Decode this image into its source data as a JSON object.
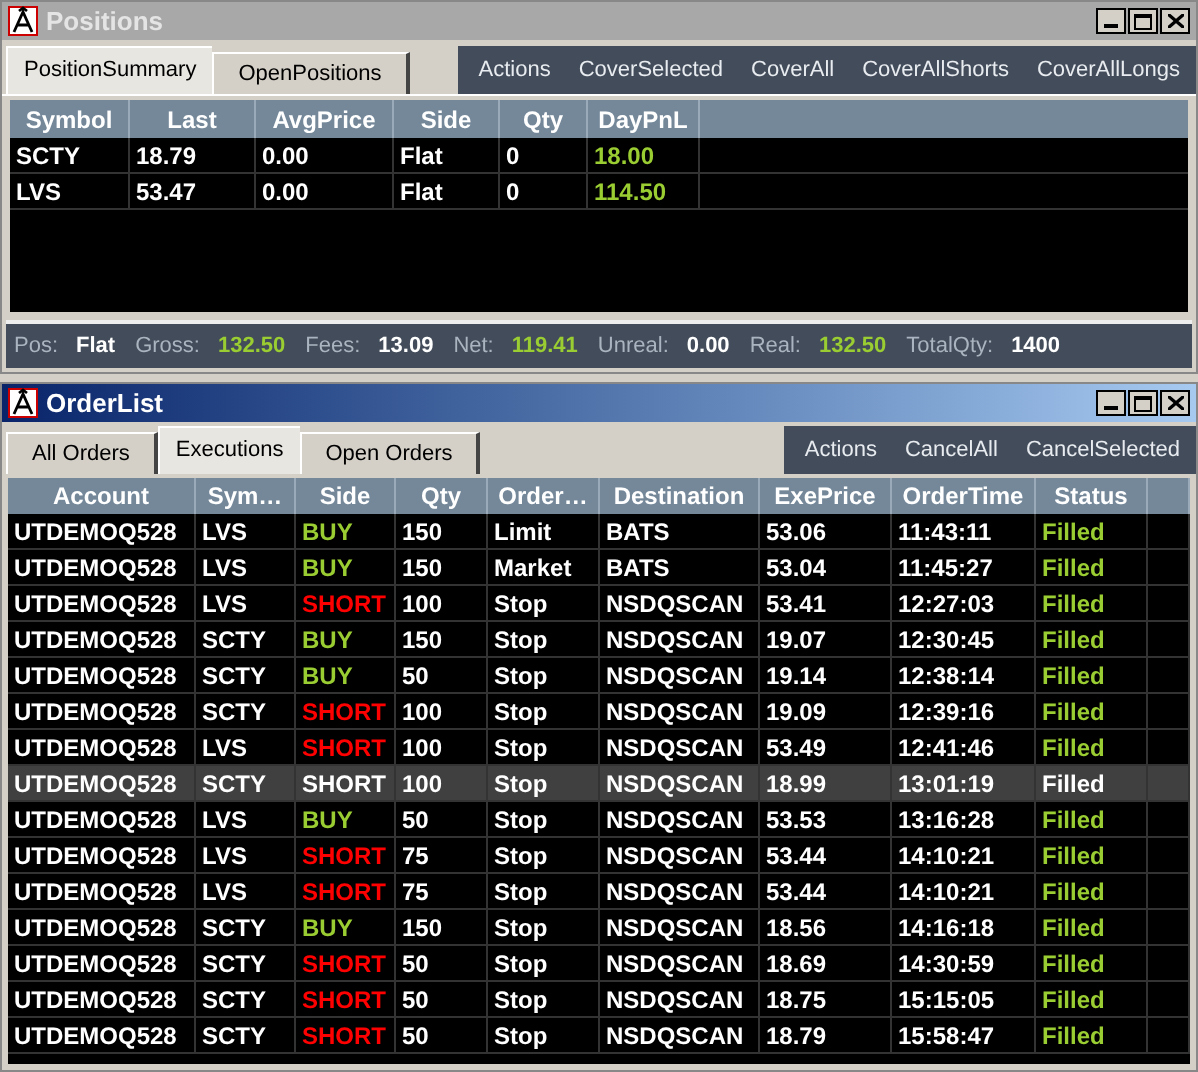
{
  "positions": {
    "title": "Positions",
    "tabs": [
      {
        "label": "PositionSummary",
        "selected": true
      },
      {
        "label": "OpenPositions",
        "selected": false
      }
    ],
    "actions": [
      "Actions",
      "CoverSelected",
      "CoverAll",
      "CoverAllShorts",
      "CoverAllLongs"
    ],
    "columns": [
      "Symbol",
      "Last",
      "AvgPrice",
      "Side",
      "Qty",
      "DayPnL"
    ],
    "rows": [
      {
        "cells": [
          "SCTY",
          "18.79",
          "0.00",
          "Flat",
          "0",
          "18.00"
        ]
      },
      {
        "cells": [
          "LVS",
          "53.47",
          "0.00",
          "Flat",
          "0",
          "114.50"
        ]
      }
    ],
    "status_bar": [
      {
        "label": "Pos:",
        "value": "Flat",
        "kind": "plain"
      },
      {
        "label": "Gross:",
        "value": "132.50",
        "kind": "gain"
      },
      {
        "label": "Fees:",
        "value": "13.09",
        "kind": "plain"
      },
      {
        "label": "Net:",
        "value": "119.41",
        "kind": "gain"
      },
      {
        "label": "Unreal:",
        "value": "0.00",
        "kind": "plain"
      },
      {
        "label": "Real:",
        "value": "132.50",
        "kind": "gain"
      },
      {
        "label": "TotalQty:",
        "value": "1400",
        "kind": "plain"
      }
    ]
  },
  "order_list": {
    "title": "OrderList",
    "tabs": [
      {
        "label": "All Orders",
        "selected": false
      },
      {
        "label": "Executions",
        "selected": true
      },
      {
        "label": "Open Orders",
        "selected": false
      }
    ],
    "actions": [
      "Actions",
      "CancelAll",
      "CancelSelected"
    ],
    "columns": [
      "Account",
      "Sym…",
      "Side",
      "Qty",
      "Order…",
      "Destination",
      "ExePrice",
      "OrderTime",
      "Status"
    ],
    "rows": [
      {
        "selected": false,
        "kind": "buy",
        "cells": [
          "UTDEMOQ528",
          "LVS",
          "BUY",
          "150",
          "Limit",
          "BATS",
          "53.06",
          "11:43:11",
          "Filled"
        ]
      },
      {
        "selected": false,
        "kind": "buy",
        "cells": [
          "UTDEMOQ528",
          "LVS",
          "BUY",
          "150",
          "Market",
          "BATS",
          "53.04",
          "11:45:27",
          "Filled"
        ]
      },
      {
        "selected": false,
        "kind": "short",
        "cells": [
          "UTDEMOQ528",
          "LVS",
          "SHORT",
          "100",
          "Stop",
          "NSDQSCAN",
          "53.41",
          "12:27:03",
          "Filled"
        ]
      },
      {
        "selected": false,
        "kind": "buy",
        "cells": [
          "UTDEMOQ528",
          "SCTY",
          "BUY",
          "150",
          "Stop",
          "NSDQSCAN",
          "19.07",
          "12:30:45",
          "Filled"
        ]
      },
      {
        "selected": false,
        "kind": "buy",
        "cells": [
          "UTDEMOQ528",
          "SCTY",
          "BUY",
          "50",
          "Stop",
          "NSDQSCAN",
          "19.14",
          "12:38:14",
          "Filled"
        ]
      },
      {
        "selected": false,
        "kind": "short",
        "cells": [
          "UTDEMOQ528",
          "SCTY",
          "SHORT",
          "100",
          "Stop",
          "NSDQSCAN",
          "19.09",
          "12:39:16",
          "Filled"
        ]
      },
      {
        "selected": false,
        "kind": "short",
        "cells": [
          "UTDEMOQ528",
          "LVS",
          "SHORT",
          "100",
          "Stop",
          "NSDQSCAN",
          "53.49",
          "12:41:46",
          "Filled"
        ]
      },
      {
        "selected": true,
        "cells": [
          "UTDEMOQ528",
          "SCTY",
          "SHORT",
          "100",
          "Stop",
          "NSDQSCAN",
          "18.99",
          "13:01:19",
          "Filled"
        ]
      },
      {
        "selected": false,
        "kind": "buy",
        "cells": [
          "UTDEMOQ528",
          "LVS",
          "BUY",
          "50",
          "Stop",
          "NSDQSCAN",
          "53.53",
          "13:16:28",
          "Filled"
        ]
      },
      {
        "selected": false,
        "kind": "short",
        "cells": [
          "UTDEMOQ528",
          "LVS",
          "SHORT",
          "75",
          "Stop",
          "NSDQSCAN",
          "53.44",
          "14:10:21",
          "Filled"
        ]
      },
      {
        "selected": false,
        "kind": "short",
        "cells": [
          "UTDEMOQ528",
          "LVS",
          "SHORT",
          "75",
          "Stop",
          "NSDQSCAN",
          "53.44",
          "14:10:21",
          "Filled"
        ]
      },
      {
        "selected": false,
        "kind": "buy",
        "cells": [
          "UTDEMOQ528",
          "SCTY",
          "BUY",
          "150",
          "Stop",
          "NSDQSCAN",
          "18.56",
          "14:16:18",
          "Filled"
        ]
      },
      {
        "selected": false,
        "kind": "short",
        "cells": [
          "UTDEMOQ528",
          "SCTY",
          "SHORT",
          "50",
          "Stop",
          "NSDQSCAN",
          "18.69",
          "14:30:59",
          "Filled"
        ]
      },
      {
        "selected": false,
        "kind": "short",
        "cells": [
          "UTDEMOQ528",
          "SCTY",
          "SHORT",
          "50",
          "Stop",
          "NSDQSCAN",
          "18.75",
          "15:15:05",
          "Filled"
        ]
      },
      {
        "selected": false,
        "kind": "short",
        "cells": [
          "UTDEMOQ528",
          "SCTY",
          "SHORT",
          "50",
          "Stop",
          "NSDQSCAN",
          "18.79",
          "15:58:47",
          "Filled"
        ]
      }
    ]
  }
}
